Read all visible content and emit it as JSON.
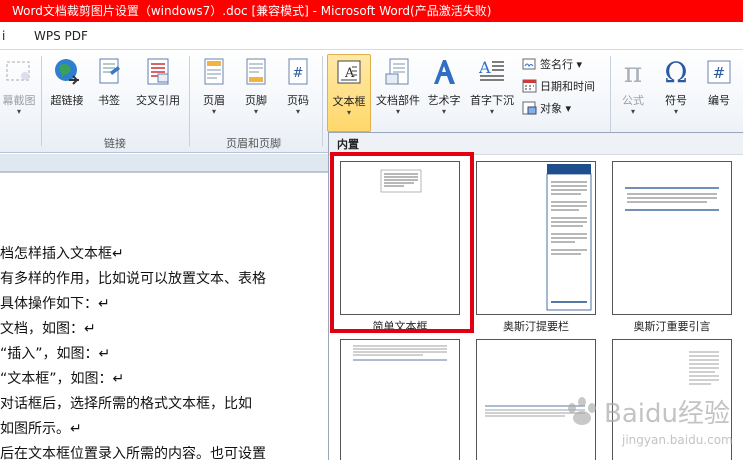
{
  "window": {
    "title": "Word文档裁剪图片设置（windows7）.doc [兼容模式] - Microsoft Word(产品激活失败)"
  },
  "menu": {
    "items": [
      "i",
      "WPS PDF"
    ]
  },
  "ribbon": {
    "screenshot_label": "幕截图",
    "hyperlink_label": "超链接",
    "bookmark_label": "书签",
    "crossref_label": "交叉引用",
    "links_group": "链接",
    "header_label": "页眉",
    "footer_label": "页脚",
    "pagenum_label": "页码",
    "header_footer_group": "页眉和页脚",
    "textbox_label": "文本框",
    "quickparts_label": "文档部件",
    "wordart_label": "艺术字",
    "dropcap_label": "首字下沉",
    "signature_label": "签名行",
    "datetime_label": "日期和时间",
    "object_label": "对象",
    "formula_label": "公式",
    "symbol_label": "符号",
    "number_label": "编号",
    "pi_glyph": "π",
    "omega_glyph": "Ω",
    "hash_glyph": "#",
    "dropdown_glyph": "▾"
  },
  "gallery": {
    "section_title": "内置",
    "items": [
      {
        "label": "简单文本框"
      },
      {
        "label": "奥斯汀提要栏"
      },
      {
        "label": "奥斯汀重要引言"
      }
    ]
  },
  "document": {
    "lines": [
      "档怎样插入文本框↵",
      "有多样的作用，比如说可以放置文本、表格",
      "具体操作如下：↵",
      "文档，如图：↵",
      "“插入”，如图：↵",
      "“文本框”，如图：↵",
      "对话框后，选择所需的格式文本框，比如",
      "如图所示。↵",
      "后在文本框位置录入所需的内容。也可设置"
    ]
  },
  "watermark": {
    "brand": "Baidu经验",
    "url": "jingyan.baidu.com"
  },
  "colors": {
    "titlebar": "#ff0000",
    "selection": "#e00012",
    "accent_blue": "#1f5fa8"
  }
}
